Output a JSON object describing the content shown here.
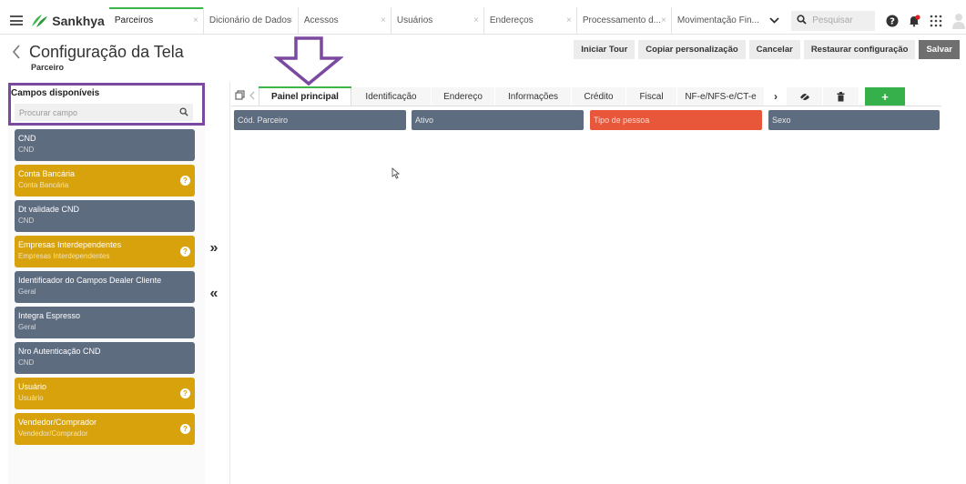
{
  "app": {
    "brand": "Sankhya",
    "tabs": [
      {
        "label": "Parceiros",
        "active": true
      },
      {
        "label": "Dicionário de Dados",
        "active": false
      },
      {
        "label": "Acessos",
        "active": false
      },
      {
        "label": "Usuários",
        "active": false
      },
      {
        "label": "Endereços",
        "active": false
      },
      {
        "label": "Processamento d...",
        "active": false
      },
      {
        "label": "Movimentação Fin...",
        "active": false
      }
    ],
    "tab_close": "×",
    "search_placeholder": "Pesquisar"
  },
  "header": {
    "title": "Configuração da Tela",
    "subtitle": "Parceiro",
    "actions": {
      "tour": "Iniciar Tour",
      "copy": "Copiar personalização",
      "cancel": "Cancelar",
      "restore": "Restaurar configuração",
      "save": "Salvar"
    }
  },
  "fields_panel": {
    "title": "Campos disponíveis",
    "search_placeholder": "Procurar campo",
    "items": [
      {
        "name": "CND",
        "group": "CND",
        "color": "slate",
        "info": false
      },
      {
        "name": "Conta Bancária",
        "group": "Conta Bancária",
        "color": "gold",
        "info": true
      },
      {
        "name": "Dt validade CND",
        "group": "CND",
        "color": "slate",
        "info": false
      },
      {
        "name": "Empresas Interdependentes",
        "group": "Empresas Interdependentes",
        "color": "gold",
        "info": true
      },
      {
        "name": "Identificador do Campos Dealer Cliente",
        "group": "Geral",
        "color": "slate",
        "info": false
      },
      {
        "name": "Integra Espresso",
        "group": "Geral",
        "color": "slate",
        "info": false
      },
      {
        "name": "Nro Autenticação CND",
        "group": "CND",
        "color": "slate",
        "info": false
      },
      {
        "name": "Usuário",
        "group": "Usuário",
        "color": "gold",
        "info": true
      },
      {
        "name": "Vendedor/Comprador",
        "group": "Vendedor/Comprador",
        "color": "gold",
        "info": true
      }
    ],
    "move_right": "»",
    "move_left": "«"
  },
  "content_tabs": {
    "tabs": [
      {
        "label": "Painel principal",
        "active": true
      },
      {
        "label": "Identificação",
        "active": false
      },
      {
        "label": "Endereço",
        "active": false
      },
      {
        "label": "Informações",
        "active": false
      },
      {
        "label": "Crédito",
        "active": false
      },
      {
        "label": "Fiscal",
        "active": false
      },
      {
        "label": "NF-e/NFS-e/CT-e",
        "active": false
      }
    ],
    "more": "›",
    "add": "+"
  },
  "layout_fields": [
    {
      "label": "Cód. Parceiro",
      "color": "slate"
    },
    {
      "label": "Ativo",
      "color": "slate"
    },
    {
      "label": "Tipo de pessoa",
      "color": "orange"
    },
    {
      "label": "Sexo",
      "color": "slate"
    }
  ],
  "colors": {
    "slate": "#5e6c80",
    "gold": "#d7a20b",
    "orange": "#e8573a",
    "green": "#35b04a",
    "annotation_purple": "#7b4aa0"
  },
  "icons": [
    "menu-icon",
    "sankhya-logo-icon",
    "search-icon",
    "help-icon",
    "notifications-icon",
    "apps-grid-icon",
    "user-avatar-icon",
    "back-icon",
    "copy-icon",
    "chevron-left-icon",
    "visibility-icon",
    "trash-icon"
  ]
}
